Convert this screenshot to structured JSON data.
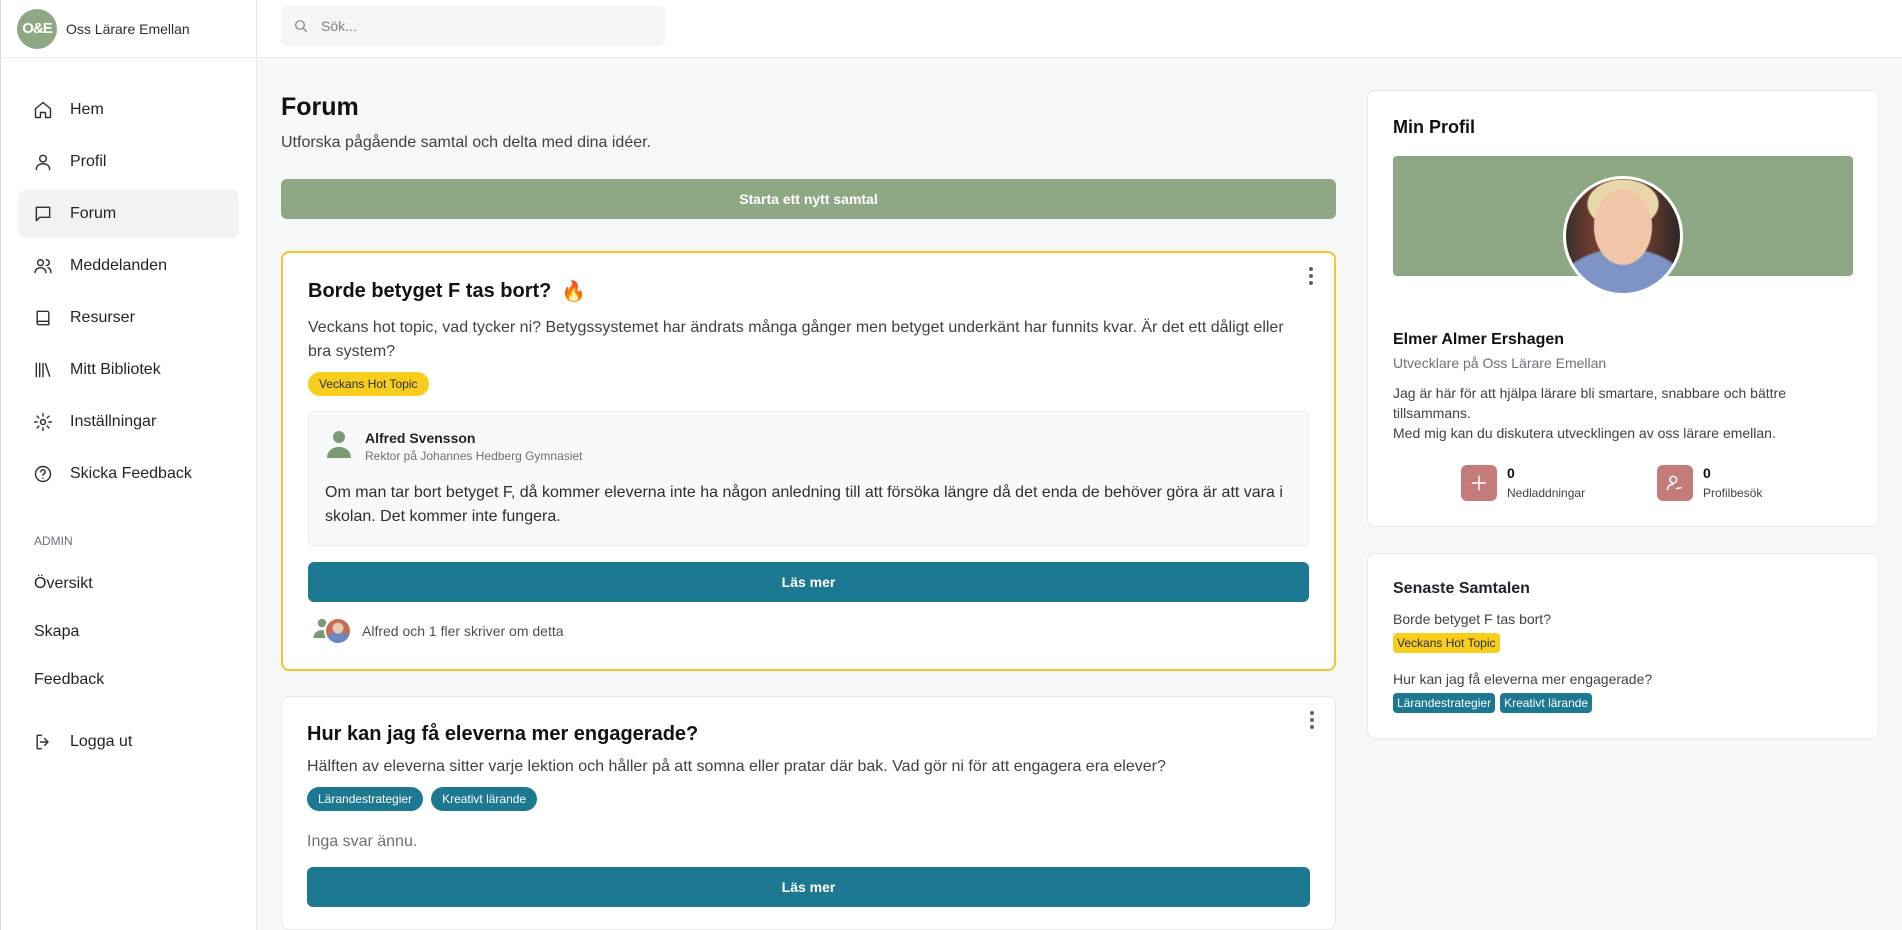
{
  "brand": {
    "logo_text": "O&E",
    "name": "Oss Lärare Emellan"
  },
  "search": {
    "placeholder": "Sök..."
  },
  "nav": [
    {
      "label": "Hem",
      "icon": "home-icon"
    },
    {
      "label": "Profil",
      "icon": "user-icon"
    },
    {
      "label": "Forum",
      "icon": "chat-icon",
      "active": true
    },
    {
      "label": "Meddelanden",
      "icon": "users-icon"
    },
    {
      "label": "Resurser",
      "icon": "book-icon"
    },
    {
      "label": "Mitt Bibliotek",
      "icon": "library-icon"
    },
    {
      "label": "Inställningar",
      "icon": "gear-icon"
    },
    {
      "label": "Skicka Feedback",
      "icon": "help-circle-icon"
    }
  ],
  "admin": {
    "title": "ADMIN",
    "items": [
      "Översikt",
      "Skapa",
      "Feedback"
    ]
  },
  "logout": {
    "label": "Logga ut",
    "icon": "logout-icon"
  },
  "main": {
    "title": "Forum",
    "subtitle": "Utforska pågående samtal och delta med dina idéer.",
    "new_button": "Starta ett nytt samtal",
    "posts": [
      {
        "title": "Borde betyget F tas bort?",
        "flame": "🔥",
        "text": "Veckans hot topic, vad tycker ni? Betygssystemet har ändrats många gånger men betyget underkänt har funnits kvar. Är det ett dåligt eller bra system?",
        "tags": [
          "Veckans Hot Topic"
        ],
        "reply": {
          "name": "Alfred Svensson",
          "role": "Rektor på Johannes Hedberg Gymnasiet",
          "text": "Om man tar bort betyget F, då kommer eleverna inte ha någon anledning till att försöka längre då det enda de behöver göra är att vara i skolan. Det kommer inte fungera."
        },
        "read_more": "Läs mer",
        "footer": "Alfred och 1 fler skriver om detta"
      },
      {
        "title": "Hur kan jag få eleverna mer engagerade?",
        "text": "Hälften av eleverna sitter varje lektion och håller på att somna eller pratar där bak. Vad gör ni för att engagera era elever?",
        "tags": [
          "Lärandestrategier",
          "Kreativt lärande"
        ],
        "no_replies": "Inga svar ännu.",
        "read_more": "Läs mer"
      }
    ]
  },
  "profile": {
    "title": "Min Profil",
    "name": "Elmer Almer Ershagen",
    "role": "Utvecklare på Oss Lärare Emellan",
    "bio_1": "Jag är här för att hjälpa lärare bli smartare, snabbare och bättre tillsammans.",
    "bio_2": "Med mig kan du diskutera utvecklingen av oss lärare emellan.",
    "stats": [
      {
        "value": "0",
        "label": "Nedladdningar",
        "icon": "plus-icon"
      },
      {
        "value": "0",
        "label": "Profilbesök",
        "icon": "user-signature-icon"
      }
    ]
  },
  "recent": {
    "title": "Senaste Samtalen",
    "items": [
      {
        "question": "Borde betyget F tas bort?",
        "tags": [
          "Veckans Hot Topic"
        ]
      },
      {
        "question": "Hur kan jag få eleverna mer engagerade?",
        "tags": [
          "Lärandestrategier",
          "Kreativt lärande"
        ]
      }
    ]
  },
  "colors": {
    "accent_green": "#8ea886",
    "teal": "#1d7891",
    "hot_yellow": "#f8cd1c",
    "stat_rose": "#c47c7a"
  }
}
